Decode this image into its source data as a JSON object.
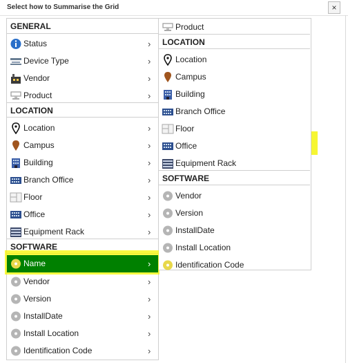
{
  "dialog": {
    "title": "Select how to Summarise the Grid",
    "close_label": "×"
  },
  "left_menu": {
    "general_header": "GENERAL",
    "general_items": [
      {
        "label": "Status",
        "icon": "info-icon"
      },
      {
        "label": "Device Type",
        "icon": "device-type-icon"
      },
      {
        "label": "Vendor",
        "icon": "vendor-icon"
      },
      {
        "label": "Product",
        "icon": "product-icon"
      }
    ],
    "location_header": "LOCATION",
    "location_items": [
      {
        "label": "Location",
        "icon": "location-pin-icon"
      },
      {
        "label": "Campus",
        "icon": "campus-icon"
      },
      {
        "label": "Building",
        "icon": "building-icon"
      },
      {
        "label": "Branch Office",
        "icon": "branch-office-icon"
      },
      {
        "label": "Floor",
        "icon": "floor-icon"
      },
      {
        "label": "Office",
        "icon": "office-icon"
      },
      {
        "label": "Equipment Rack",
        "icon": "equipment-rack-icon"
      }
    ],
    "software_header": "SOFTWARE",
    "software_items": [
      {
        "label": "Name",
        "icon": "disc-icon",
        "selected": true
      },
      {
        "label": "Vendor",
        "icon": "disc-icon"
      },
      {
        "label": "Version",
        "icon": "disc-icon"
      },
      {
        "label": "InstallDate",
        "icon": "disc-icon"
      },
      {
        "label": "Install Location",
        "icon": "disc-icon"
      },
      {
        "label": "Identification Code",
        "icon": "disc-icon"
      }
    ],
    "chevron": "›"
  },
  "right_menu": {
    "top_item": {
      "label": "Product",
      "icon": "product-icon"
    },
    "location_header": "LOCATION",
    "location_items": [
      {
        "label": "Location",
        "icon": "location-pin-icon"
      },
      {
        "label": "Campus",
        "icon": "campus-icon"
      },
      {
        "label": "Building",
        "icon": "building-icon"
      },
      {
        "label": "Branch Office",
        "icon": "branch-office-icon"
      },
      {
        "label": "Floor",
        "icon": "floor-icon"
      },
      {
        "label": "Office",
        "icon": "office-icon",
        "highlighted": true
      },
      {
        "label": "Equipment Rack",
        "icon": "equipment-rack-icon"
      }
    ],
    "software_header": "SOFTWARE",
    "software_items": [
      {
        "label": "Vendor",
        "icon": "disc-icon"
      },
      {
        "label": "Version",
        "icon": "disc-icon"
      },
      {
        "label": "InstallDate",
        "icon": "disc-icon"
      },
      {
        "label": "Install Location",
        "icon": "disc-icon"
      },
      {
        "label": "Identification Code",
        "icon": "disc-icon"
      }
    ]
  },
  "colors": {
    "selected_bg": "#008000",
    "highlight": "#f7f700"
  }
}
